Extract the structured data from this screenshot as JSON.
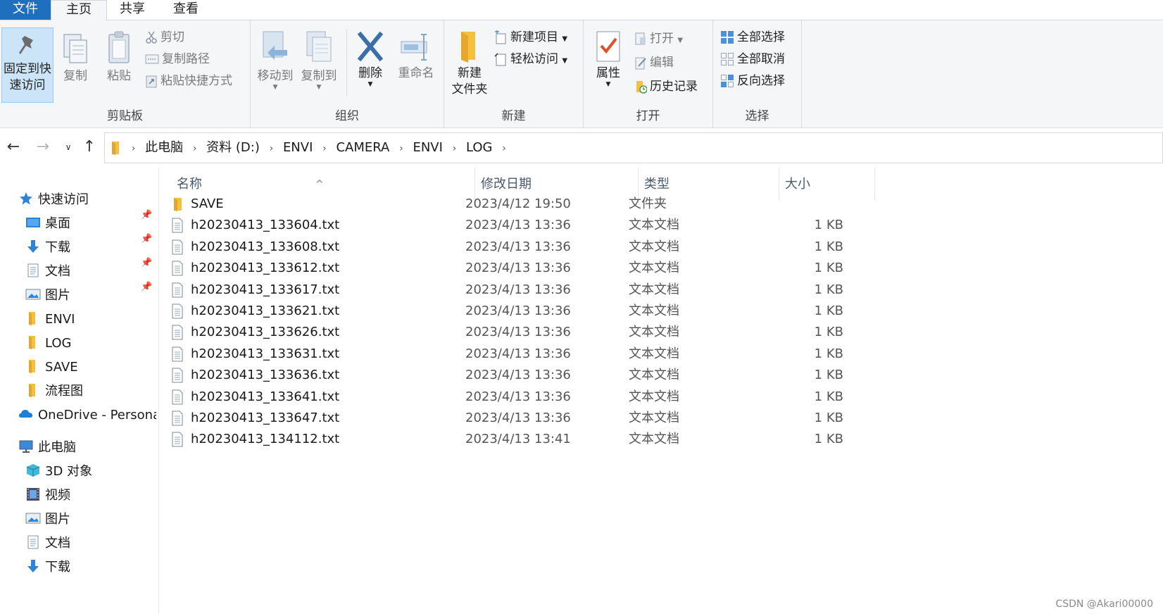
{
  "tabs": {
    "file": "文件",
    "home": "主页",
    "share": "共享",
    "view": "查看"
  },
  "ribbon": {
    "clipboard": {
      "label": "剪贴板",
      "pin_line1": "固定到快",
      "pin_line2": "速访问",
      "copy": "复制",
      "paste": "粘贴",
      "cut": "剪切",
      "copy_path": "复制路径",
      "paste_shortcut": "粘贴快捷方式"
    },
    "organize": {
      "label": "组织",
      "move_to": "移动到",
      "copy_to": "复制到",
      "delete": "删除",
      "rename": "重命名"
    },
    "new": {
      "label": "新建",
      "new_folder_line1": "新建",
      "new_folder_line2": "文件夹",
      "new_item": "新建项目",
      "easy_access": "轻松访问"
    },
    "open": {
      "label": "打开",
      "properties": "属性",
      "open": "打开",
      "edit": "编辑",
      "history": "历史记录"
    },
    "select": {
      "label": "选择",
      "select_all": "全部选择",
      "select_none": "全部取消",
      "invert": "反向选择"
    }
  },
  "address": {
    "crumbs": [
      "此电脑",
      "资料 (D:)",
      "ENVI",
      "CAMERA",
      "ENVI",
      "LOG"
    ]
  },
  "sidebar": {
    "quick_access": "快速访问",
    "quick_items": [
      "桌面",
      "下载",
      "文档",
      "图片",
      "ENVI",
      "LOG",
      "SAVE",
      "流程图"
    ],
    "onedrive": "OneDrive - Personal",
    "this_pc": "此电脑",
    "pc_items": [
      "3D 对象",
      "视频",
      "图片",
      "文档",
      "下载"
    ]
  },
  "columns": {
    "name": "名称",
    "date": "修改日期",
    "type": "类型",
    "size": "大小"
  },
  "files": [
    {
      "name": "SAVE",
      "date": "2023/4/12 19:50",
      "type": "文件夹",
      "size": "",
      "kind": "folder"
    },
    {
      "name": "h20230413_133604.txt",
      "date": "2023/4/13 13:36",
      "type": "文本文档",
      "size": "1 KB",
      "kind": "txt"
    },
    {
      "name": "h20230413_133608.txt",
      "date": "2023/4/13 13:36",
      "type": "文本文档",
      "size": "1 KB",
      "kind": "txt"
    },
    {
      "name": "h20230413_133612.txt",
      "date": "2023/4/13 13:36",
      "type": "文本文档",
      "size": "1 KB",
      "kind": "txt"
    },
    {
      "name": "h20230413_133617.txt",
      "date": "2023/4/13 13:36",
      "type": "文本文档",
      "size": "1 KB",
      "kind": "txt"
    },
    {
      "name": "h20230413_133621.txt",
      "date": "2023/4/13 13:36",
      "type": "文本文档",
      "size": "1 KB",
      "kind": "txt"
    },
    {
      "name": "h20230413_133626.txt",
      "date": "2023/4/13 13:36",
      "type": "文本文档",
      "size": "1 KB",
      "kind": "txt"
    },
    {
      "name": "h20230413_133631.txt",
      "date": "2023/4/13 13:36",
      "type": "文本文档",
      "size": "1 KB",
      "kind": "txt"
    },
    {
      "name": "h20230413_133636.txt",
      "date": "2023/4/13 13:36",
      "type": "文本文档",
      "size": "1 KB",
      "kind": "txt"
    },
    {
      "name": "h20230413_133641.txt",
      "date": "2023/4/13 13:36",
      "type": "文本文档",
      "size": "1 KB",
      "kind": "txt"
    },
    {
      "name": "h20230413_133647.txt",
      "date": "2023/4/13 13:36",
      "type": "文本文档",
      "size": "1 KB",
      "kind": "txt"
    },
    {
      "name": "h20230413_134112.txt",
      "date": "2023/4/13 13:41",
      "type": "文本文档",
      "size": "1 KB",
      "kind": "txt"
    }
  ],
  "watermark": "CSDN @Akari00000",
  "colors": {
    "accent": "#1f6fbf",
    "folder": "#f3c13f",
    "pin_highlight": "#cce4f7"
  }
}
